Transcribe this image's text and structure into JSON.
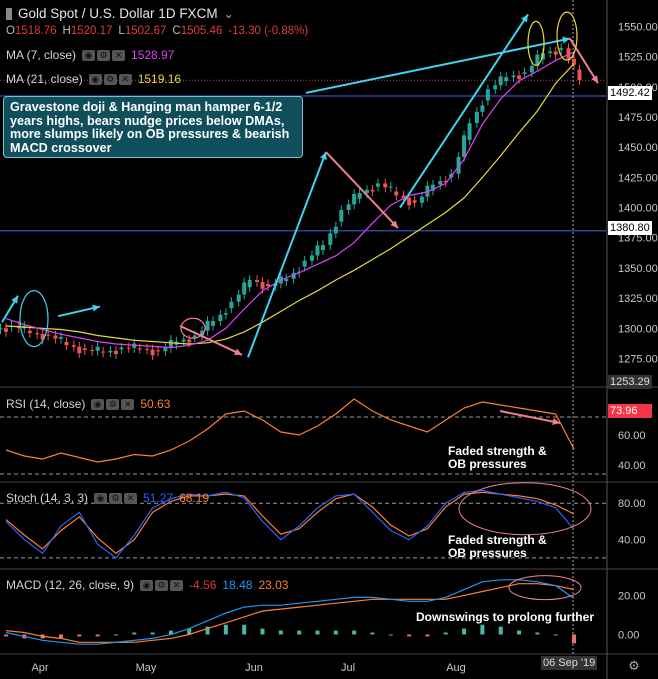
{
  "header": {
    "title": "Gold Spot / U.S. Dollar  1D  FXCM",
    "open_label": "O",
    "open": "1518.76",
    "high_label": "H",
    "high": "1520.17",
    "low_label": "L",
    "low": "1502.67",
    "close_label": "C",
    "close": "1505.46",
    "change": "-13.30 (-0.88%)"
  },
  "indicators": {
    "ma7": {
      "label": "MA (7, close)",
      "value": "1528.97",
      "color": "#e040fb"
    },
    "ma21": {
      "label": "MA (21, close)",
      "value": "1519.16",
      "color": "#e8d83a"
    },
    "rsi": {
      "label": "RSI (14, close)",
      "value": "50.63",
      "color": "#ff7f2a"
    },
    "stoch": {
      "label": "Stoch (14, 3, 3)",
      "k": "51.27",
      "d": "68.19",
      "k_color": "#2962ff",
      "d_color": "#ff7f2a"
    },
    "macd": {
      "label": "MACD (12, 26, close, 9)",
      "hist": "-4.56",
      "macd": "18.48",
      "signal": "23.03",
      "hist_color": "#e03a3a",
      "macd_color": "#2196f3",
      "signal_color": "#ff7f2a"
    }
  },
  "annotations": {
    "callout": "Gravestone doji & Hanging man hamper 6-1/2 years highs, bears nudge prices below DMAs, more slumps likely on OB pressures & bearish MACD crossover",
    "rsi_note_1": "Faded strength &",
    "rsi_note_2": "OB pressures",
    "stoch_note_1": "Faded strength &",
    "stoch_note_2": "OB pressures",
    "macd_note": "Downswings to prolong further"
  },
  "price_axis": {
    "tag_upper": "1492.42",
    "tag_lower": "1380.80",
    "tag_bottom": "1253.29",
    "tag_rsi": "73.96"
  },
  "date_tag": "06 Sep '19",
  "colors": {
    "up": "#26a69a",
    "down": "#ef5350",
    "accent": "#f23645",
    "callout_bg": "#0f4e5a"
  },
  "chart_data": [
    {
      "type": "candlestick",
      "title": "Gold Spot / U.S. Dollar  1D  FXCM",
      "x": [
        "Apr",
        "May",
        "Jun",
        "Jul",
        "Aug"
      ],
      "y_ticks": [
        1275,
        1300,
        1325,
        1350,
        1375,
        1400,
        1425,
        1450,
        1475,
        1500,
        1525,
        1550
      ],
      "ylim": [
        1253,
        1562
      ],
      "series": [
        {
          "name": "MA (7, close)",
          "values": [
            1308,
            1303,
            1299,
            1295,
            1292,
            1289,
            1287,
            1286,
            1285,
            1284,
            1286,
            1290,
            1300,
            1316,
            1331,
            1340,
            1346,
            1353,
            1360,
            1371,
            1387,
            1402,
            1410,
            1413,
            1420,
            1440,
            1469,
            1490,
            1505,
            1513,
            1522,
            1528.97
          ]
        },
        {
          "name": "MA (21, close)",
          "values": [
            1302,
            1301,
            1300,
            1299,
            1297,
            1294,
            1292,
            1290,
            1289,
            1288,
            1287,
            1288,
            1291,
            1297,
            1305,
            1314,
            1323,
            1331,
            1340,
            1348,
            1357,
            1366,
            1376,
            1386,
            1396,
            1408,
            1425,
            1443,
            1462,
            1480,
            1503,
            1519.16
          ]
        }
      ],
      "values": [
        1302,
        1296,
        1294,
        1286,
        1282,
        1280,
        1284,
        1283,
        1281,
        1289,
        1294,
        1306,
        1322,
        1340,
        1335,
        1341,
        1356,
        1369,
        1398,
        1412,
        1420,
        1410,
        1404,
        1419,
        1428,
        1470,
        1498,
        1508,
        1512,
        1528,
        1532,
        1505.46
      ],
      "horizontal_lines": [
        1492.42,
        1380.8
      ]
    },
    {
      "type": "line",
      "title": "RSI (14, close)",
      "ylim": [
        30,
        90
      ],
      "y_ticks": [
        40,
        60
      ],
      "series": [
        {
          "name": "RSI",
          "values": [
            50,
            46,
            44,
            48,
            45,
            42,
            44,
            47,
            46,
            50,
            56,
            64,
            74,
            76,
            70,
            62,
            60,
            66,
            74,
            84,
            76,
            70,
            66,
            62,
            70,
            78,
            82,
            80,
            78,
            76,
            73.96,
            50.63
          ]
        }
      ]
    },
    {
      "type": "line",
      "title": "Stoch (14, 3, 3)",
      "ylim": [
        10,
        100
      ],
      "y_ticks": [
        40,
        80
      ],
      "series": [
        {
          "name": "K",
          "values": [
            60,
            40,
            25,
            55,
            70,
            35,
            20,
            45,
            75,
            85,
            90,
            88,
            92,
            86,
            60,
            40,
            55,
            75,
            88,
            90,
            70,
            50,
            40,
            55,
            80,
            92,
            94,
            90,
            86,
            82,
            75,
            51.27
          ]
        },
        {
          "name": "D",
          "values": [
            62,
            45,
            30,
            50,
            65,
            42,
            25,
            40,
            70,
            82,
            88,
            88,
            90,
            88,
            66,
            46,
            52,
            70,
            85,
            90,
            76,
            56,
            44,
            52,
            76,
            90,
            92,
            90,
            88,
            85,
            78,
            68.19
          ]
        }
      ]
    },
    {
      "type": "line",
      "title": "MACD (12, 26, close, 9)",
      "ylim": [
        -10,
        32
      ],
      "y_ticks": [
        0,
        20
      ],
      "series": [
        {
          "name": "MACD",
          "values": [
            1,
            -1,
            -3,
            -4,
            -5,
            -5,
            -4,
            -3,
            -2,
            0,
            3,
            7,
            11,
            14,
            15,
            15,
            16,
            17,
            18,
            19,
            19,
            18,
            17,
            17,
            19,
            23,
            27,
            28,
            28,
            27,
            25,
            18.48
          ]
        },
        {
          "name": "Signal",
          "values": [
            2,
            1,
            -1,
            -2,
            -4,
            -4,
            -4,
            -4,
            -3,
            -2,
            0,
            3,
            6,
            9,
            12,
            13,
            14,
            15,
            16,
            17,
            18,
            18,
            18,
            18,
            18,
            20,
            22,
            24,
            26,
            26,
            25,
            23.03
          ]
        },
        {
          "name": "Histogram",
          "values": [
            -1,
            -2,
            -2,
            -2,
            -1,
            -1,
            0,
            1,
            1,
            2,
            3,
            4,
            5,
            5,
            3,
            2,
            2,
            2,
            2,
            2,
            1,
            0,
            -1,
            -1,
            1,
            3,
            5,
            4,
            2,
            1,
            0,
            -4.56
          ]
        }
      ]
    }
  ]
}
